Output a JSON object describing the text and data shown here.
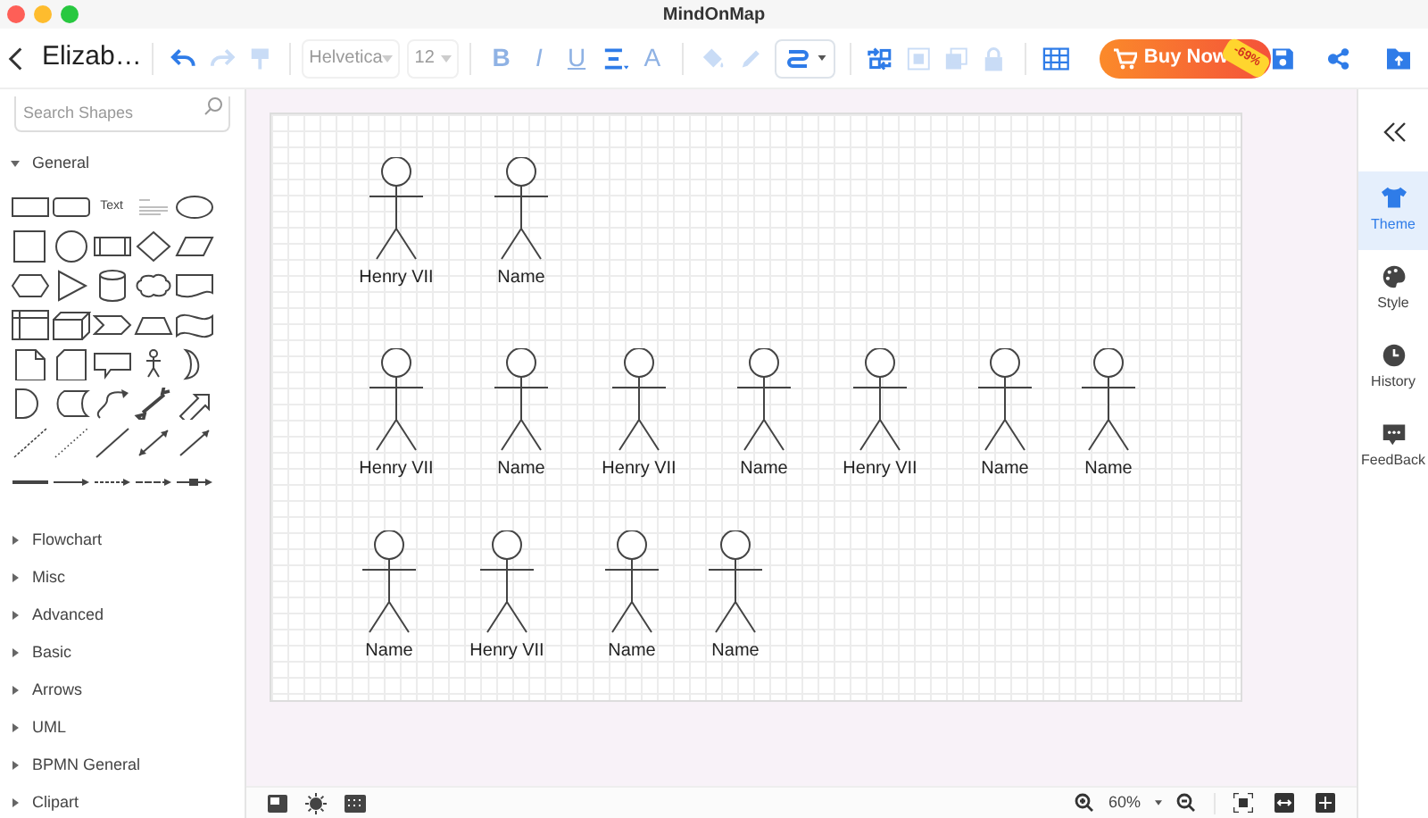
{
  "window": {
    "title": "MindOnMap"
  },
  "toolbar": {
    "document_title": "Elizab…",
    "history_tools": [
      {
        "kind": "undo",
        "disabled": false
      },
      {
        "kind": "redo",
        "disabled": true
      },
      {
        "kind": "format-painter",
        "disabled": true
      }
    ],
    "font": {
      "value": "Helvetica",
      "disabled": true
    },
    "font_size": {
      "value": "12",
      "disabled": true
    },
    "text_tools": [
      {
        "kind": "bold",
        "label": "B",
        "disabled": true
      },
      {
        "kind": "italic",
        "label": "I",
        "disabled": true
      },
      {
        "kind": "underline",
        "label": "U",
        "disabled": true
      },
      {
        "kind": "align",
        "disabled": false
      },
      {
        "kind": "font-color",
        "label": "A",
        "disabled": true
      }
    ],
    "style_tools": [
      {
        "kind": "fill",
        "disabled": true,
        "selected": false
      },
      {
        "kind": "line-color",
        "disabled": true,
        "selected": false
      },
      {
        "kind": "connector",
        "disabled": false,
        "selected": true
      }
    ],
    "arrange_tools": [
      {
        "kind": "arrange",
        "disabled": false
      },
      {
        "kind": "front",
        "disabled": true
      },
      {
        "kind": "back",
        "disabled": true
      },
      {
        "kind": "lock",
        "disabled": true
      },
      {
        "kind": "table",
        "disabled": false
      }
    ],
    "buy_button": {
      "label": "Buy Now",
      "badge": "-69%"
    }
  },
  "shape_library": {
    "search": {
      "placeholder": "Search Shapes"
    },
    "text_shape_label": "Text",
    "sections": [
      {
        "label": "General",
        "expanded": true
      },
      {
        "label": "Flowchart",
        "expanded": false
      },
      {
        "label": "Misc",
        "expanded": false
      },
      {
        "label": "Advanced",
        "expanded": false
      },
      {
        "label": "Basic",
        "expanded": false
      },
      {
        "label": "Arrows",
        "expanded": false
      },
      {
        "label": "UML",
        "expanded": false
      },
      {
        "label": "BPMN General",
        "expanded": false
      },
      {
        "label": "Clipart",
        "expanded": false
      }
    ]
  },
  "canvas": {
    "rows": [
      [
        {
          "label": "Henry VII"
        },
        {
          "label": "Name"
        }
      ],
      [
        {
          "label": "Henry VII"
        },
        {
          "label": "Name"
        },
        {
          "label": "Henry VII"
        },
        {
          "label": "Name"
        },
        {
          "label": "Henry VII"
        },
        {
          "label": "Name"
        },
        {
          "label": "Name"
        }
      ],
      [
        {
          "label": "Name"
        },
        {
          "label": "Henry VII"
        },
        {
          "label": "Name"
        },
        {
          "label": "Name"
        }
      ]
    ]
  },
  "right_panel": {
    "tabs": [
      {
        "label": "Theme",
        "selected": true
      },
      {
        "label": "Style",
        "selected": false
      },
      {
        "label": "History",
        "selected": false
      },
      {
        "label": "FeedBack",
        "selected": false
      }
    ]
  },
  "status_bar": {
    "zoom": "60%"
  }
}
